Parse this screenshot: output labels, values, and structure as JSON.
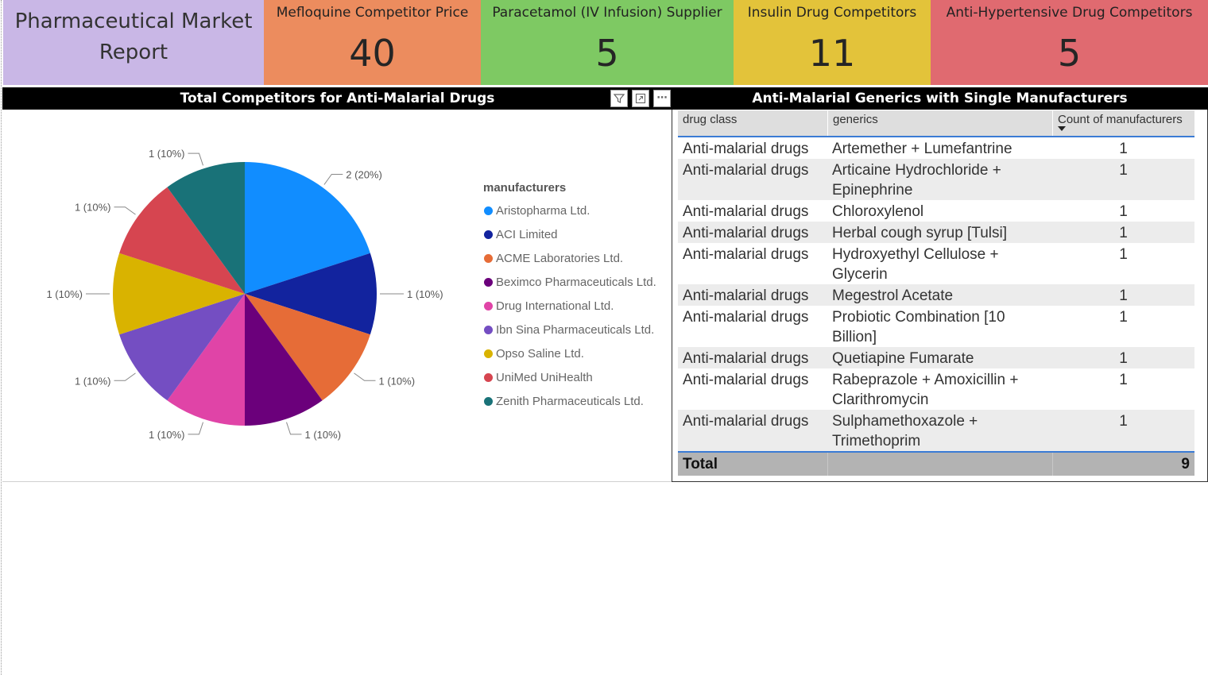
{
  "report_title": "Pharmaceutical Market Report",
  "kpis": [
    {
      "label": "Mefloquine Competitor Price",
      "value": "40",
      "color": "#ec8c5e"
    },
    {
      "label": "Paracetamol (IV Infusion) Supplier",
      "value": "5",
      "color": "#7ec963"
    },
    {
      "label": "Insulin Drug Competitors",
      "value": "11",
      "color": "#e3c33a"
    },
    {
      "label": "Anti-Hypertensive Drug Competitors",
      "value": "5",
      "color": "#e06a70"
    }
  ],
  "pie_panel": {
    "title": "Total Competitors for Anti-Malarial Drugs",
    "legend_title": "manufacturers",
    "icons": [
      "filter-icon",
      "focus-mode-icon",
      "more-options-icon"
    ]
  },
  "chart_data": {
    "type": "pie",
    "title": "Total Competitors for Anti-Malarial Drugs",
    "legend_title": "manufacturers",
    "legend_position": "right",
    "slices": [
      {
        "name": "Aristopharma Ltd.",
        "value": 2,
        "label": "2 (20%)",
        "color": "#118DFF"
      },
      {
        "name": "ACI Limited",
        "value": 1,
        "label": "1 (10%)",
        "color": "#12239E"
      },
      {
        "name": "ACME Laboratories Ltd.",
        "value": 1,
        "label": "1 (10%)",
        "color": "#E66C37"
      },
      {
        "name": "Beximco Pharmaceuticals Ltd.",
        "value": 1,
        "label": "1 (10%)",
        "color": "#6B007B"
      },
      {
        "name": "Drug International Ltd.",
        "value": 1,
        "label": "1 (10%)",
        "color": "#E044A7"
      },
      {
        "name": "Ibn Sina Pharmaceuticals Ltd.",
        "value": 1,
        "label": "1 (10%)",
        "color": "#744EC2"
      },
      {
        "name": "Opso Saline Ltd.",
        "value": 1,
        "label": "1 (10%)",
        "color": "#D9B300"
      },
      {
        "name": "UniMed UniHealth",
        "value": 1,
        "label": "1 (10%)",
        "color": "#D64550"
      },
      {
        "name": "Zenith Pharmaceuticals Ltd.",
        "value": 1,
        "label": "1 (10%)",
        "color": "#197278"
      }
    ]
  },
  "table_panel": {
    "title": "Anti-Malarial Generics with Single Manufacturers",
    "columns": [
      "drug class",
      "generics",
      "Count of manufacturers"
    ],
    "rows": [
      [
        "Anti-malarial drugs",
        "Artemether + Lumefantrine",
        "1"
      ],
      [
        "Anti-malarial drugs",
        "Articaine Hydrochloride + Epinephrine",
        "1"
      ],
      [
        "Anti-malarial drugs",
        "Chloroxylenol",
        "1"
      ],
      [
        "Anti-malarial drugs",
        "Herbal cough syrup [Tulsi]",
        "1"
      ],
      [
        "Anti-malarial drugs",
        "Hydroxyethyl Cellulose + Glycerin",
        "1"
      ],
      [
        "Anti-malarial drugs",
        "Megestrol Acetate",
        "1"
      ],
      [
        "Anti-malarial drugs",
        "Probiotic Combination [10 Billion]",
        "1"
      ],
      [
        "Anti-malarial drugs",
        "Quetiapine Fumarate",
        "1"
      ],
      [
        "Anti-malarial drugs",
        "Rabeprazole + Amoxicillin + Clarithromycin",
        "1"
      ],
      [
        "Anti-malarial drugs",
        "Sulphamethoxazole + Trimethoprim",
        "1"
      ]
    ],
    "total_label": "Total",
    "total_value": "9"
  }
}
